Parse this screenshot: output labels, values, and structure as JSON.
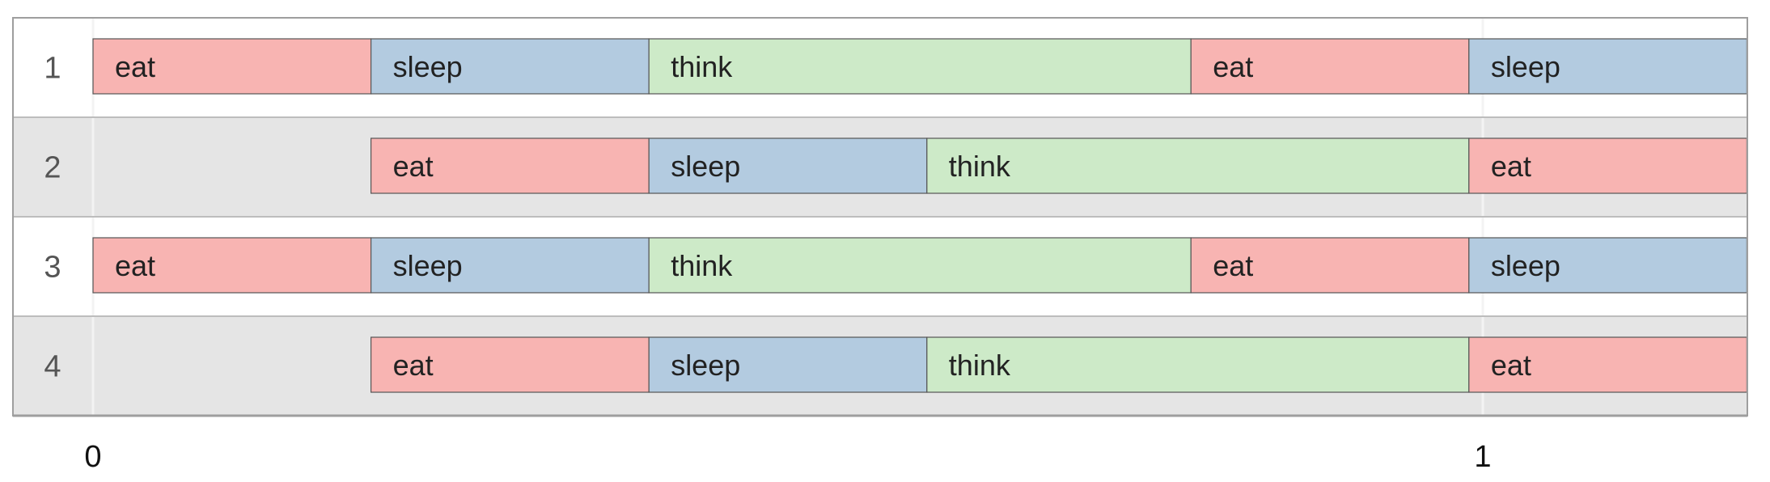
{
  "chart_data": {
    "type": "gantt",
    "x_ticks": [
      0,
      1
    ],
    "x_range": [
      0,
      1.19
    ],
    "grid": true,
    "colors": {
      "eat": "#f8b4b2",
      "sleep": "#b3cbe0",
      "think": "#cdeac8",
      "lane_odd": "#ffffff",
      "lane_even": "#e5e5e5",
      "border": "#555555",
      "grid": "#f3f3f3"
    },
    "lanes": [
      {
        "label": "1",
        "segments": [
          {
            "label": "eat",
            "start": 0.0,
            "end": 0.2
          },
          {
            "label": "sleep",
            "start": 0.2,
            "end": 0.4
          },
          {
            "label": "think",
            "start": 0.4,
            "end": 0.79
          },
          {
            "label": "eat",
            "start": 0.79,
            "end": 0.99
          },
          {
            "label": "sleep",
            "start": 0.99,
            "end": 1.19
          }
        ]
      },
      {
        "label": "2",
        "segments": [
          {
            "label": "eat",
            "start": 0.2,
            "end": 0.4
          },
          {
            "label": "sleep",
            "start": 0.4,
            "end": 0.6
          },
          {
            "label": "think",
            "start": 0.6,
            "end": 0.99
          },
          {
            "label": "eat",
            "start": 0.99,
            "end": 1.19
          }
        ]
      },
      {
        "label": "3",
        "segments": [
          {
            "label": "eat",
            "start": 0.0,
            "end": 0.2
          },
          {
            "label": "sleep",
            "start": 0.2,
            "end": 0.4
          },
          {
            "label": "think",
            "start": 0.4,
            "end": 0.79
          },
          {
            "label": "eat",
            "start": 0.79,
            "end": 0.99
          },
          {
            "label": "sleep",
            "start": 0.99,
            "end": 1.19
          }
        ]
      },
      {
        "label": "4",
        "segments": [
          {
            "label": "eat",
            "start": 0.2,
            "end": 0.4
          },
          {
            "label": "sleep",
            "start": 0.4,
            "end": 0.6
          },
          {
            "label": "think",
            "start": 0.6,
            "end": 0.99
          },
          {
            "label": "eat",
            "start": 0.99,
            "end": 1.19
          }
        ]
      }
    ]
  }
}
